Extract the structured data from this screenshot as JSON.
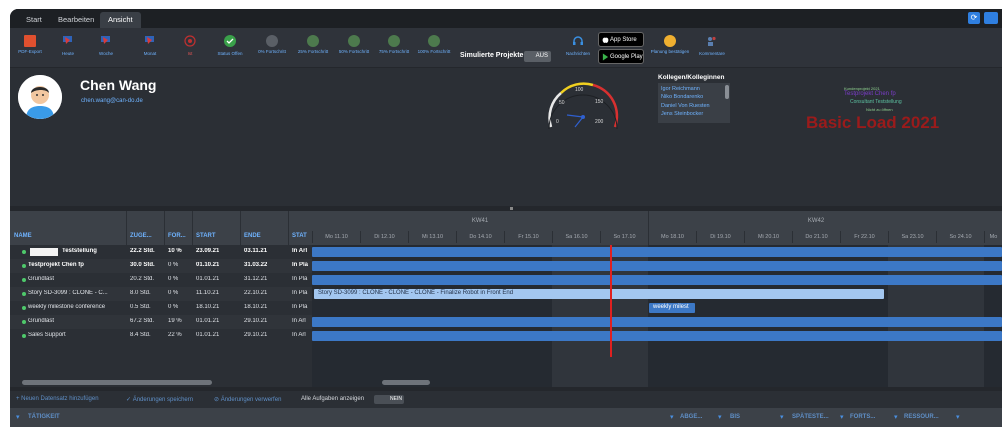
{
  "tabs": [
    {
      "label": "Start"
    },
    {
      "label": "Bearbeiten"
    },
    {
      "label": "Ansicht"
    }
  ],
  "toolbar": {
    "tools": [
      {
        "label": "PDF-Export",
        "icon": "pdf-icon",
        "color": "#e0502f"
      },
      {
        "label": "Heute",
        "icon": "pin-icon",
        "color": "#d93a3a"
      },
      {
        "label": "Woche",
        "icon": "pin-icon",
        "color": "#d93a3a"
      },
      {
        "label": "Monat",
        "icon": "pin-icon",
        "color": "#d93a3a"
      },
      {
        "label": "Ist",
        "icon": "target-icon",
        "color": "#c03030"
      },
      {
        "label": "Status Offen",
        "icon": "check-circle-icon",
        "color": "#3aa14a"
      },
      {
        "label": "0% Fortschritt",
        "icon": "progress-circle-icon",
        "color": "#5a5f66"
      },
      {
        "label": "25% Fortschritt",
        "icon": "progress-circle-icon",
        "color": "#4d7a4d"
      },
      {
        "label": "50% Fortschritt",
        "icon": "progress-circle-icon",
        "color": "#4d7a4d"
      },
      {
        "label": "75% Fortschritt",
        "icon": "progress-circle-icon",
        "color": "#4d7a4d"
      },
      {
        "label": "100% Fortschritt",
        "icon": "progress-circle-icon",
        "color": "#4d7a4d"
      }
    ],
    "simulate_label": "Simulierte Projekte:",
    "simulate_value": "AUS",
    "news_label": "Nachrichten",
    "app_store": "App Store",
    "google_play": "Google Play",
    "planning_label": "Planung bestätigen",
    "comments_label": "Kommentare"
  },
  "profile": {
    "name": "Chen Wang",
    "email": "chen.wang@can-do.de",
    "gauge_ticks": [
      "50",
      "100",
      "150",
      "200",
      "0"
    ],
    "colleagues_title": "Kollegen/Kolleginnen",
    "colleagues": [
      "Igor Reichmann",
      "Niko Bondarenko",
      "Daniel Von Ruesten",
      "Jens Steinbocker"
    ],
    "tags": [
      "Kundenprojekt 2021",
      "Testprojekt Chen fp",
      "Consultant Teststellung",
      "Nicht zu öffnen"
    ],
    "big_title": "Basic Load 2021"
  },
  "grid": {
    "columns": [
      "NAME",
      "ZUGE...",
      "FOR...",
      "START",
      "ENDE",
      "STAT"
    ],
    "rows": [
      {
        "name": "Teststellung",
        "hours": "22.2 Std.",
        "progress": "10 %",
        "start": "23.09.21",
        "end": "03.11.21",
        "status": "In Arl",
        "bold": true,
        "box": true
      },
      {
        "name": "Testprojekt Chen fp",
        "hours": "30.0 Std.",
        "progress": "0 %",
        "start": "01.10.21",
        "end": "31.03.22",
        "status": "In Pla",
        "bold": true,
        "box": false
      },
      {
        "name": "Grundlast",
        "hours": "20.2 Std.",
        "progress": "0 %",
        "start": "01.01.21",
        "end": "31.12.21",
        "status": "In Pla",
        "bold": false,
        "box": false
      },
      {
        "name": "Story SD-3099 : CLONE - C...",
        "hours": "8.0 Std.",
        "progress": "0 %",
        "start": "11.10.21",
        "end": "22.10.21",
        "status": "In Pla",
        "bold": false,
        "box": false
      },
      {
        "name": "weekly milestone conference",
        "hours": "0.5 Std.",
        "progress": "0 %",
        "start": "18.10.21",
        "end": "18.10.21",
        "status": "In Pla",
        "bold": false,
        "box": false
      },
      {
        "name": "Grundlast",
        "hours": "67.2 Std.",
        "progress": "19 %",
        "start": "01.01.21",
        "end": "29.10.21",
        "status": "In Arl",
        "bold": false,
        "box": false
      },
      {
        "name": "Sales Support",
        "hours": "8.4 Std.",
        "progress": "22 %",
        "start": "01.01.21",
        "end": "29.10.21",
        "status": "In Arl",
        "bold": false,
        "box": false
      }
    ]
  },
  "gantt": {
    "weeks": [
      "KW41",
      "KW42"
    ],
    "days": [
      "Mo 11.10",
      "Di 12.10",
      "Mi 13.10",
      "Do 14.10",
      "Fr 15.10",
      "Sa 16.10",
      "So 17.10",
      "Mo 18.10",
      "Di 19.10",
      "Mi 20.10",
      "Do 21.10",
      "Fr 22.10",
      "Sa 23.10",
      "So 24.10",
      "Mo"
    ],
    "story_label": "Story SD-3099 : CLONE - CLONE - CLONE - Finalize Robot in Front End",
    "meeting_label": "weekly milest"
  },
  "bottom": {
    "add_label": "+ Neuen Datensatz hinzufügen",
    "save_label": "✓ Änderungen speichern",
    "discard_label": "⊘ Änderungen verwerfen",
    "show_all_label": "Alle Aufgaben anzeigen",
    "show_all_value": "NEIN"
  },
  "footer_columns": [
    "TÄTIGKEIT",
    "ABGE...",
    "BIS",
    "SPÄTESTE...",
    "FORTS...",
    "RESSOUR..."
  ]
}
